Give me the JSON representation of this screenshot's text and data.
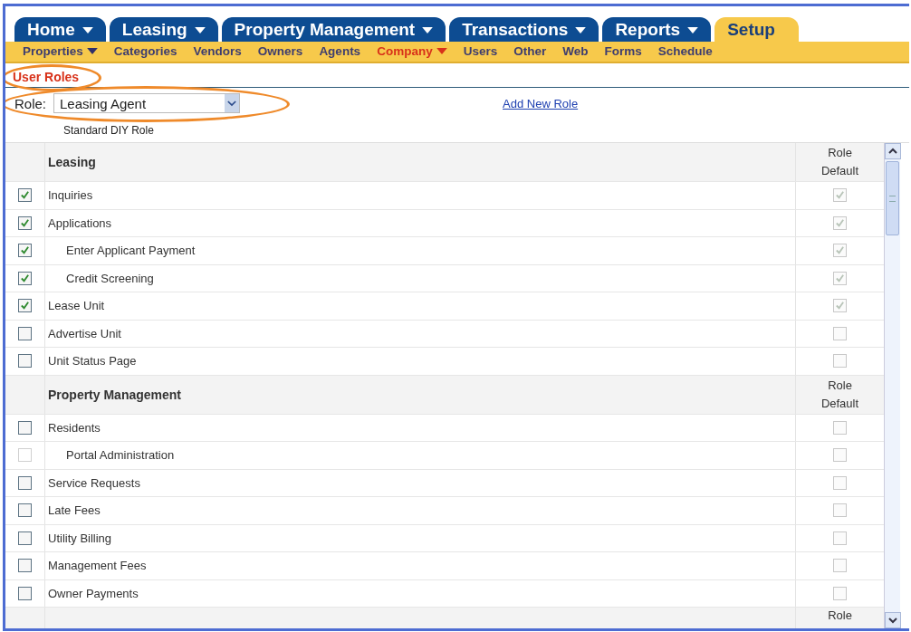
{
  "tabs": [
    {
      "label": "Home",
      "has_menu": true,
      "selected": false
    },
    {
      "label": "Leasing",
      "has_menu": true,
      "selected": false
    },
    {
      "label": "Property Management",
      "has_menu": true,
      "selected": false
    },
    {
      "label": "Transactions",
      "has_menu": true,
      "selected": false
    },
    {
      "label": "Reports",
      "has_menu": true,
      "selected": false
    },
    {
      "label": "Setup",
      "has_menu": false,
      "selected": true
    }
  ],
  "subnav": [
    {
      "label": "Properties",
      "has_menu": true,
      "selected": false
    },
    {
      "label": "Categories",
      "has_menu": false,
      "selected": false
    },
    {
      "label": "Vendors",
      "has_menu": false,
      "selected": false
    },
    {
      "label": "Owners",
      "has_menu": false,
      "selected": false
    },
    {
      "label": "Agents",
      "has_menu": false,
      "selected": false
    },
    {
      "label": "Company",
      "has_menu": true,
      "selected": true
    },
    {
      "label": "Users",
      "has_menu": false,
      "selected": false
    },
    {
      "label": "Other",
      "has_menu": false,
      "selected": false
    },
    {
      "label": "Web",
      "has_menu": false,
      "selected": false
    },
    {
      "label": "Forms",
      "has_menu": false,
      "selected": false
    },
    {
      "label": "Schedule",
      "has_menu": false,
      "selected": false
    }
  ],
  "breadcrumb": {
    "label": "User Roles",
    "highlighted": true
  },
  "role": {
    "label": "Role:",
    "value": "Leasing Agent",
    "highlighted": true,
    "link": "Add New Role",
    "description": "Standard DIY Role"
  },
  "sections": [
    {
      "title": "Leasing",
      "default_label": "Role Default",
      "items": [
        {
          "label": "Inquiries",
          "checked": true,
          "disabled": false,
          "default_checked": true
        },
        {
          "label": "Applications",
          "checked": true,
          "disabled": false,
          "default_checked": true,
          "children": [
            {
              "label": "Enter Applicant Payment",
              "checked": true,
              "disabled": false,
              "default_checked": true
            },
            {
              "label": "Credit Screening",
              "checked": true,
              "disabled": false,
              "default_checked": true
            }
          ]
        },
        {
          "label": "Lease Unit",
          "checked": true,
          "disabled": false,
          "default_checked": true
        },
        {
          "label": "Advertise Unit",
          "checked": false,
          "disabled": false,
          "default_checked": false
        },
        {
          "label": "Unit Status Page",
          "checked": false,
          "disabled": false,
          "default_checked": false
        }
      ]
    },
    {
      "title": "Property Management",
      "default_label": "Role Default",
      "items": [
        {
          "label": "Residents",
          "checked": false,
          "disabled": false,
          "default_checked": false,
          "children": [
            {
              "label": "Portal Administration",
              "checked": false,
              "disabled": true,
              "default_checked": false
            }
          ]
        },
        {
          "label": "Service Requests",
          "checked": false,
          "disabled": false,
          "default_checked": false
        },
        {
          "label": "Late Fees",
          "checked": false,
          "disabled": false,
          "default_checked": false
        },
        {
          "label": "Utility Billing",
          "checked": false,
          "disabled": false,
          "default_checked": false
        },
        {
          "label": "Management Fees",
          "checked": false,
          "disabled": false,
          "default_checked": false
        },
        {
          "label": "Owner Payments",
          "checked": false,
          "disabled": false,
          "default_checked": false
        }
      ]
    },
    {
      "default_label": "Role"
    }
  ]
}
